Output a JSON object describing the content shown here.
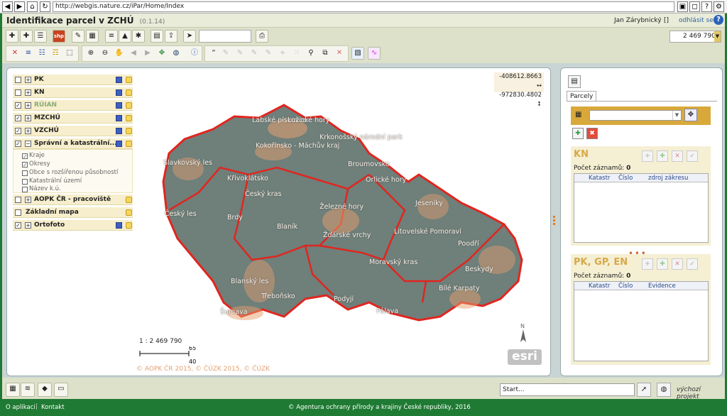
{
  "browser": {
    "url": "http://webgis.nature.cz/iPar/Home/Index",
    "back_icon": "back-arrow-icon",
    "forward_icon": "forward-arrow-icon",
    "home_icon": "home-icon",
    "refresh_icon": "refresh-icon"
  },
  "app": {
    "title": "Identifikace parcel v ZCHÚ",
    "version": "(0.1.14)",
    "user": "Jan Zárybnický",
    "user_bracket": "[]",
    "logout": "odhlásit se",
    "help": "?"
  },
  "toolbar": {
    "scale_value": "2 469 790",
    "shp_label": "shp"
  },
  "layers": [
    {
      "name": "PK",
      "checked": false
    },
    {
      "name": "KN",
      "checked": false
    },
    {
      "name": "RÚIAN",
      "checked": true
    },
    {
      "name": "MZCHÚ",
      "checked": true
    },
    {
      "name": "VZCHÚ",
      "checked": true
    },
    {
      "name": "Správní a katastrální...",
      "checked": true,
      "expanded": true
    },
    {
      "name": "AOPK ČR - pracoviště",
      "checked": false
    },
    {
      "name": "Základní mapa",
      "checked": false
    },
    {
      "name": "Ortofoto",
      "checked": true
    }
  ],
  "sublayers": [
    {
      "name": "Kraje",
      "checked": true
    },
    {
      "name": "Okresy",
      "checked": true
    },
    {
      "name": "Obce s rozšířenou působností",
      "checked": false
    },
    {
      "name": "Katastrální území",
      "checked": false
    },
    {
      "name": "Název k.ú.",
      "checked": false
    }
  ],
  "map": {
    "coord_x": "-408612.8663",
    "coord_y": "-972830.4802",
    "scale_text": "1 : 2 469 790",
    "scalebar_km": "65km",
    "scalebar_mi": "40mi",
    "copyright": "© AOPK ČR 2015, © ČÚZK 2015, © ČÚZK",
    "esri": "esri",
    "north": "N",
    "labels": [
      "Labské pískovce",
      "Lužické hory",
      "Krkonošský národní park",
      "Kokořínsko - Máchův kraj",
      "Slavkovský les",
      "Broumovsko",
      "Orlické hory",
      "Křivoklátsko",
      "Český kras",
      "Jeseníky",
      "Český les",
      "Brdy",
      "Blaník",
      "Železné hory",
      "Litovelské Pomoraví",
      "Žďárské vrchy",
      "Poodří",
      "Beskydy",
      "Moravský kras",
      "Blanský les",
      "Třeboňsko",
      "Bílé Karpaty",
      "Šumava",
      "Podyjí",
      "Pálava"
    ],
    "colors": {
      "border": "#e0261f",
      "land": "#6f7f7a",
      "protected": "#e6a06e"
    }
  },
  "right_panel": {
    "tab": "Parcely",
    "kn": {
      "title": "KN",
      "count_label": "Počet záznamů:",
      "count": "0",
      "columns": [
        "Katastr",
        "Číslo",
        "zdroj zákresu"
      ]
    },
    "pk": {
      "title": "PK, GP, EN",
      "count_label": "Počet záznamů:",
      "count": "0",
      "columns": [
        "Katastr",
        "Číslo",
        "Evidence"
      ]
    }
  },
  "bottom": {
    "start_value": "Start...",
    "default_project": "výchozí projekt"
  },
  "footer": {
    "about": "O aplikaci",
    "separator": "|",
    "contact": "Kontakt",
    "copyright": "© Agentura ochrany přírody a krajiny České republiky, 2016"
  }
}
